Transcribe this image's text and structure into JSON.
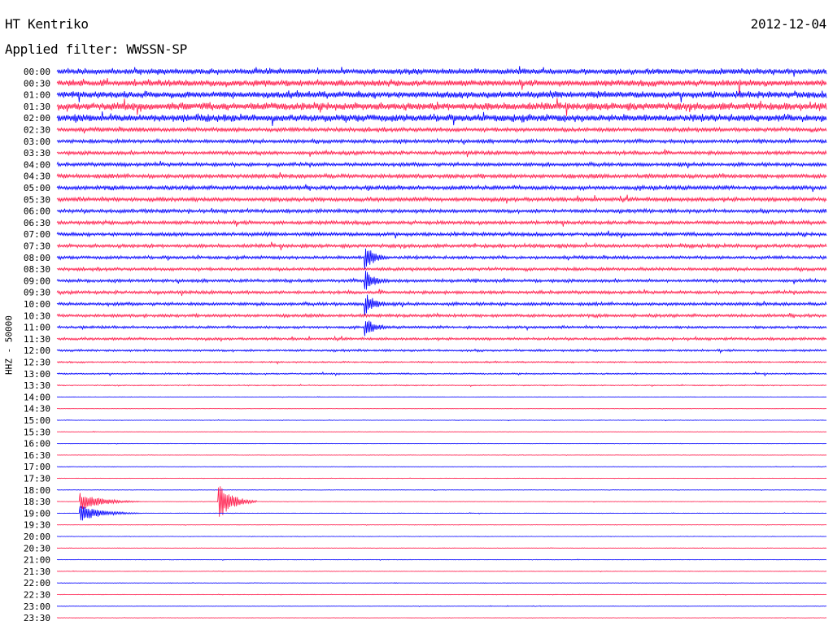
{
  "header": {
    "station": "HT Kentriko",
    "filter": "Applied filter: WWSSN-SP",
    "date": "2012-12-04"
  },
  "chart_data": {
    "type": "line",
    "title": "HT Kentriko",
    "subtitle": "Applied filter: WWSSN-SP",
    "date": "2012-12-04",
    "ylabel": "HHZ - 50000",
    "row_labels": [
      "00:00",
      "00:30",
      "01:00",
      "01:30",
      "02:00",
      "02:30",
      "03:00",
      "03:30",
      "04:00",
      "04:30",
      "05:00",
      "05:30",
      "06:00",
      "06:30",
      "07:00",
      "07:30",
      "08:00",
      "08:30",
      "09:00",
      "09:30",
      "10:00",
      "10:30",
      "11:00",
      "11:30",
      "12:00",
      "12:30",
      "13:00",
      "13:30",
      "14:00",
      "14:30",
      "15:00",
      "15:30",
      "16:00",
      "16:30",
      "17:00",
      "17:30",
      "18:00",
      "18:30",
      "19:00",
      "19:30",
      "20:00",
      "20:30",
      "21:00",
      "21:30",
      "22:00",
      "22:30",
      "23:00",
      "23:30"
    ],
    "row_colors": [
      "#0000ff",
      "#ff1a4a"
    ],
    "noise_amplitude": [
      11,
      12,
      13,
      15,
      14,
      8,
      7,
      7,
      7,
      8,
      8,
      8,
      7,
      7,
      7,
      7,
      6,
      6,
      6,
      6,
      6,
      6,
      5,
      5,
      4,
      3,
      3,
      2,
      1,
      1,
      1,
      1,
      1,
      1,
      1,
      1,
      1,
      1,
      1,
      1,
      1,
      1,
      1,
      1,
      1,
      1,
      1,
      1
    ],
    "events": [
      {
        "row": 16,
        "x_fraction": 0.4,
        "amplitude": 32,
        "duration_fraction": 0.04
      },
      {
        "row": 18,
        "x_fraction": 0.4,
        "amplitude": 28,
        "duration_fraction": 0.04
      },
      {
        "row": 20,
        "x_fraction": 0.4,
        "amplitude": 30,
        "duration_fraction": 0.04
      },
      {
        "row": 22,
        "x_fraction": 0.4,
        "amplitude": 26,
        "duration_fraction": 0.04
      },
      {
        "row": 37,
        "x_fraction": 0.21,
        "amplitude": 46,
        "duration_fraction": 0.05
      },
      {
        "row": 37,
        "x_fraction": 0.03,
        "amplitude": 22,
        "duration_fraction": 0.08
      },
      {
        "row": 38,
        "x_fraction": 0.03,
        "amplitude": 20,
        "duration_fraction": 0.08
      },
      {
        "row": 1,
        "x_fraction": 0.886,
        "amplitude": 60,
        "duration_fraction": 0.004
      }
    ]
  }
}
